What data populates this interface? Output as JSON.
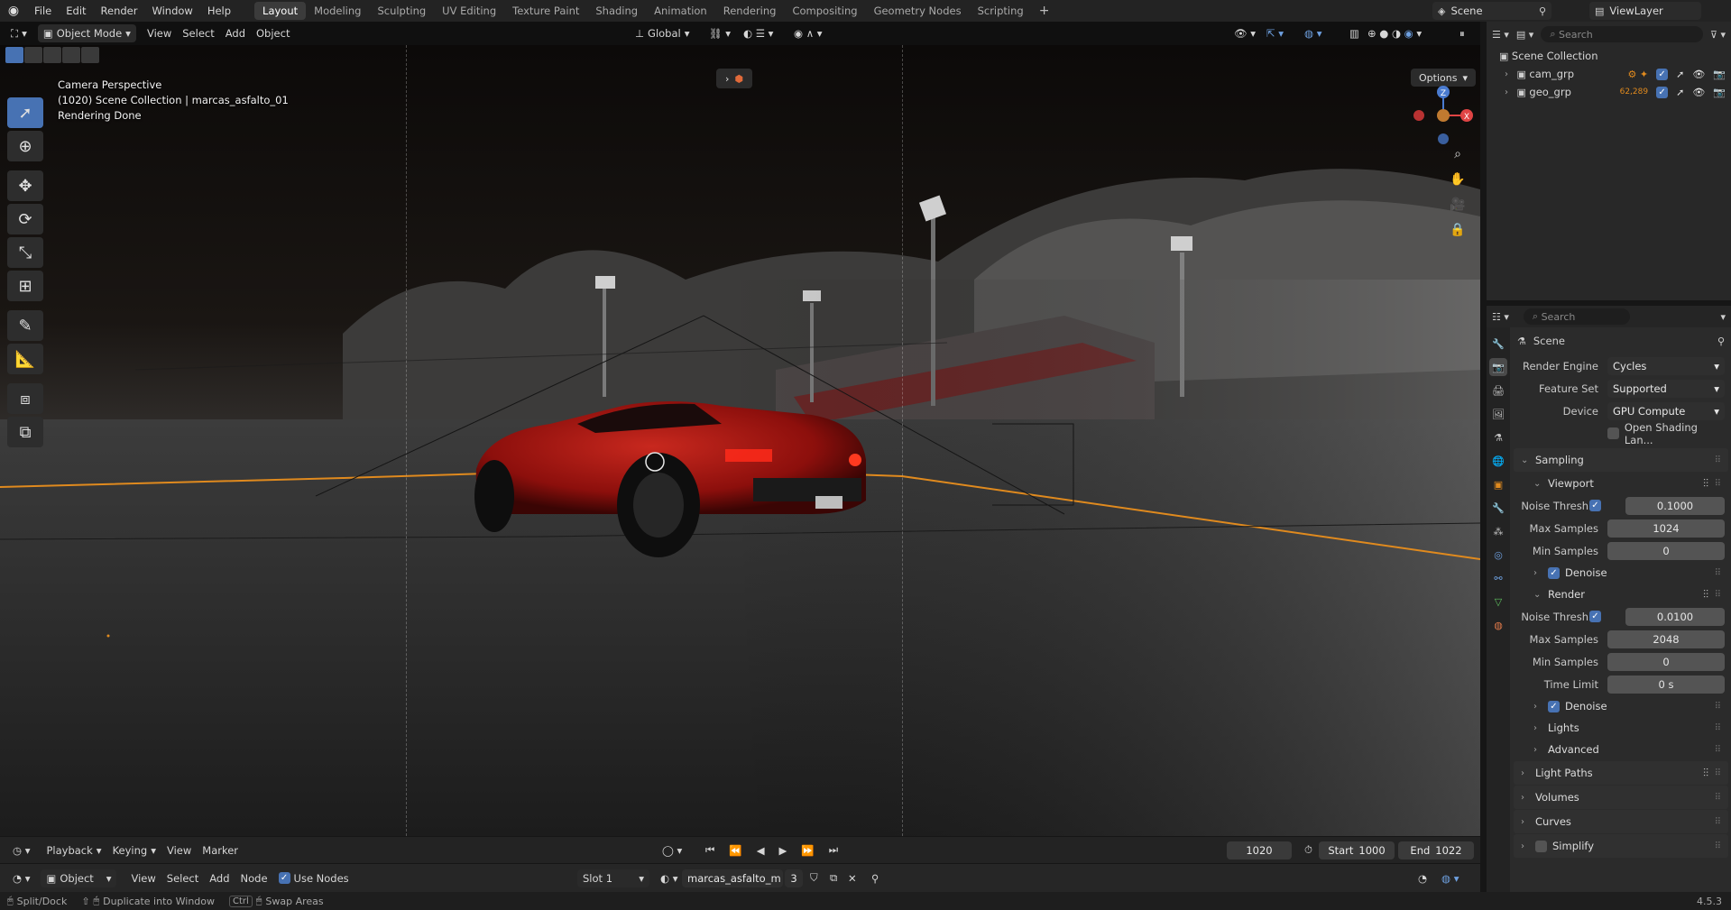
{
  "app": {
    "menus": [
      "File",
      "Edit",
      "Render",
      "Window",
      "Help"
    ],
    "workspaces": [
      "Layout",
      "Modeling",
      "Sculpting",
      "UV Editing",
      "Texture Paint",
      "Shading",
      "Animation",
      "Rendering",
      "Compositing",
      "Geometry Nodes",
      "Scripting"
    ],
    "active_workspace": "Layout",
    "scene": "Scene",
    "view_layer": "ViewLayer",
    "version": "4.5.3"
  },
  "viewport": {
    "mode": "Object Mode",
    "menus": [
      "View",
      "Select",
      "Add",
      "Object"
    ],
    "transform_orientation": "Global",
    "options": "Options",
    "info_lines": [
      "Camera Perspective",
      "(1020) Scene Collection | marcas_asfalto_01",
      "Rendering Done"
    ],
    "gizmo_axes": {
      "z": "Z",
      "x": "X"
    }
  },
  "timeline": {
    "menus": [
      "Playback",
      "Keying",
      "View",
      "Marker"
    ],
    "current_frame": "1020",
    "start_label": "Start",
    "start": "1000",
    "end_label": "End",
    "end": "1022"
  },
  "node_editor": {
    "type": "Object",
    "menus": [
      "View",
      "Select",
      "Add",
      "Node"
    ],
    "use_nodes": "Use Nodes",
    "slot": "Slot 1",
    "material": "marcas_asfalto_m",
    "users": "3"
  },
  "status": {
    "items": [
      "Split/Dock",
      "Duplicate into Window",
      "Swap Areas"
    ],
    "ctrl": "Ctrl"
  },
  "outliner": {
    "search_placeholder": "Search",
    "root": "Scene Collection",
    "collections": [
      {
        "name": "cam_grp"
      },
      {
        "name": "geo_grp",
        "badge": "62,289"
      }
    ]
  },
  "properties": {
    "search_placeholder": "Search",
    "context": "Scene",
    "render_engine_label": "Render Engine",
    "render_engine": "Cycles",
    "feature_set_label": "Feature Set",
    "feature_set": "Supported",
    "device_label": "Device",
    "device": "GPU Compute",
    "osl": "Open Shading Lan...",
    "sampling": "Sampling",
    "viewport_panel": "Viewport",
    "noise_threshold_label": "Noise Thresh...",
    "viewport_noise": "0.1000",
    "max_samples_label": "Max Samples",
    "viewport_max": "1024",
    "min_samples_label": "Min Samples",
    "viewport_min": "0",
    "denoise": "Denoise",
    "render_panel": "Render",
    "render_noise": "0.0100",
    "render_max": "2048",
    "render_min": "0",
    "time_limit_label": "Time Limit",
    "time_limit": "0 s",
    "lights": "Lights",
    "advanced": "Advanced",
    "light_paths": "Light Paths",
    "volumes": "Volumes",
    "curves": "Curves",
    "simplify": "Simplify"
  },
  "colors": {
    "accent": "#4772b3",
    "car_red": "#a01010",
    "guide_orange": "#e08a1e",
    "gizmo_x": "#e04444",
    "gizmo_z": "#4a7bd0"
  }
}
